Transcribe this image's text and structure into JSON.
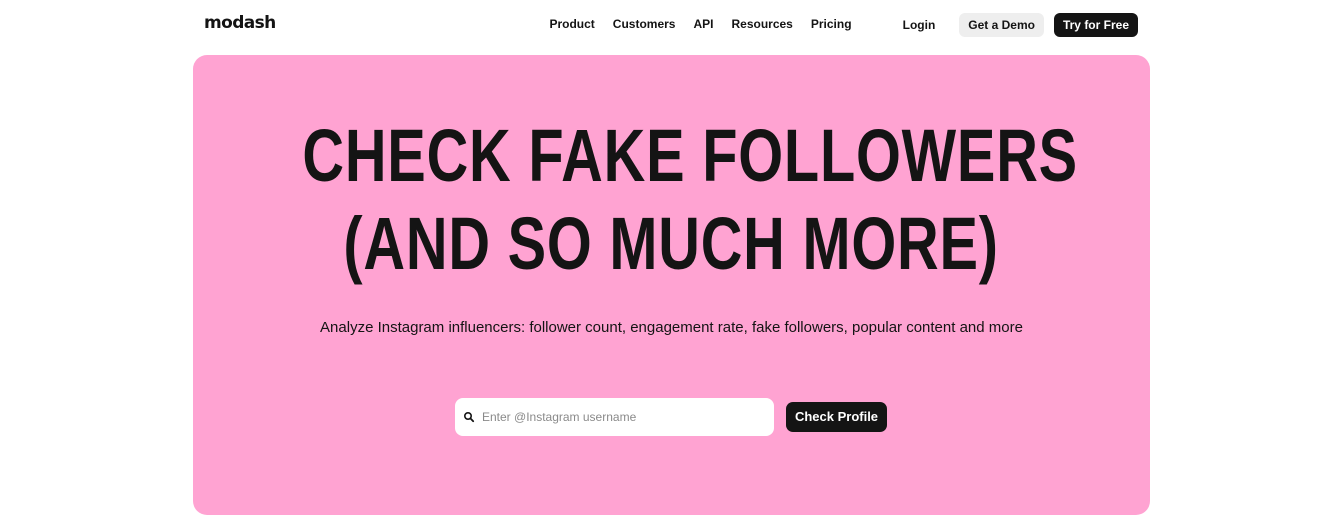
{
  "nav": {
    "logo": "modash",
    "links": [
      "Product",
      "Customers",
      "API",
      "Resources",
      "Pricing"
    ],
    "login": "Login",
    "demo_button": "Get a Demo",
    "try_button": "Try for Free"
  },
  "hero": {
    "headline_line1": "CHECK FAKE FOLLOWERS",
    "headline_line2": "(AND SO MUCH MORE)",
    "subtitle": "Analyze Instagram influencers: follower count, engagement rate, fake followers, popular content and more",
    "search": {
      "placeholder": "Enter @Instagram username",
      "value": ""
    },
    "check_button": "Check Profile"
  },
  "colors": {
    "hero_background": "#ffa3d2",
    "primary_dark": "#141414",
    "secondary_button": "#eeeeee"
  },
  "icons": {
    "search": "search-icon"
  }
}
